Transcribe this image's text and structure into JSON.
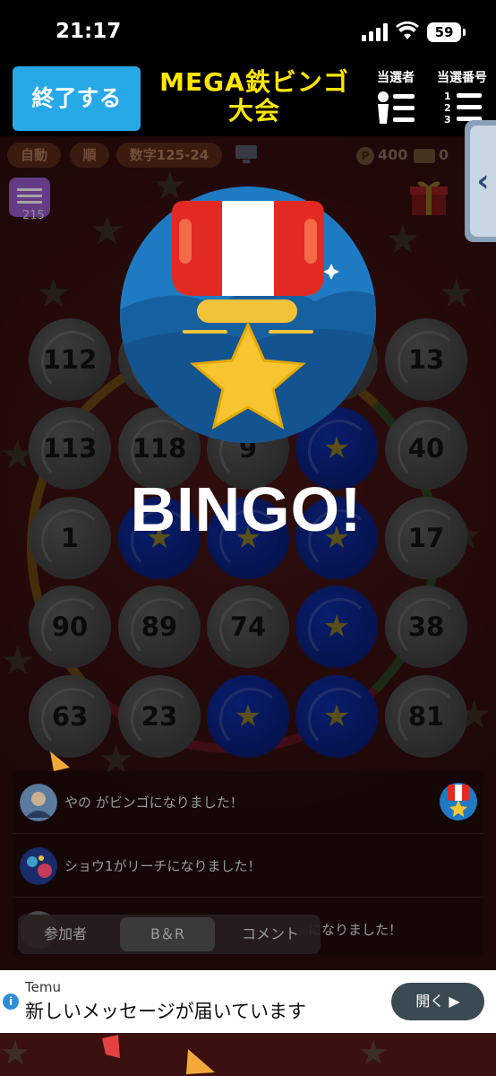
{
  "status_bar": {
    "time": "21:17",
    "battery": "59"
  },
  "header": {
    "end_button_label": "終了する",
    "title": "MEGA鉄ビンゴ大会",
    "winners_label": "当選者",
    "numbers_label": "当選番号"
  },
  "info_row": {
    "mode": "自動",
    "order": "順",
    "number_range": "数字125-24",
    "points": "400",
    "tickets": "0"
  },
  "chat": {
    "count": "215"
  },
  "board": {
    "cells": [
      {
        "value": "112",
        "marked": false
      },
      {
        "value": "",
        "marked": false
      },
      {
        "value": "",
        "marked": false
      },
      {
        "value": "",
        "marked": false
      },
      {
        "value": "13",
        "marked": false
      },
      {
        "value": "113",
        "marked": false
      },
      {
        "value": "118",
        "marked": false
      },
      {
        "value": "9",
        "marked": false
      },
      {
        "value": "★",
        "marked": true
      },
      {
        "value": "40",
        "marked": false
      },
      {
        "value": "1",
        "marked": false
      },
      {
        "value": "★",
        "marked": true
      },
      {
        "value": "★",
        "marked": true
      },
      {
        "value": "★",
        "marked": true
      },
      {
        "value": "17",
        "marked": false
      },
      {
        "value": "90",
        "marked": false
      },
      {
        "value": "89",
        "marked": false
      },
      {
        "value": "74",
        "marked": false
      },
      {
        "value": "★",
        "marked": true
      },
      {
        "value": "38",
        "marked": false
      },
      {
        "value": "63",
        "marked": false
      },
      {
        "value": "23",
        "marked": false
      },
      {
        "value": "★",
        "marked": true
      },
      {
        "value": "★",
        "marked": true
      },
      {
        "value": "81",
        "marked": false
      }
    ]
  },
  "overlay": {
    "bingo_text": "BINGO!"
  },
  "feed": {
    "items": [
      {
        "text": "やの がビンゴになりました！"
      },
      {
        "text": "ショウ1がリーチになりました！"
      },
      {
        "text": "になりました！"
      }
    ]
  },
  "tabs": {
    "participants": "参加者",
    "br": "B＆R",
    "comments": "コメント"
  },
  "notification": {
    "source": "Temu",
    "message": "新しいメッセージが届いています",
    "button_label": "開く ▶"
  },
  "colors": {
    "accent_blue": "#27a9e8",
    "title_yellow": "#ffe600",
    "marked_ball": "#0a2080",
    "chat_purple": "#9b59d0"
  }
}
